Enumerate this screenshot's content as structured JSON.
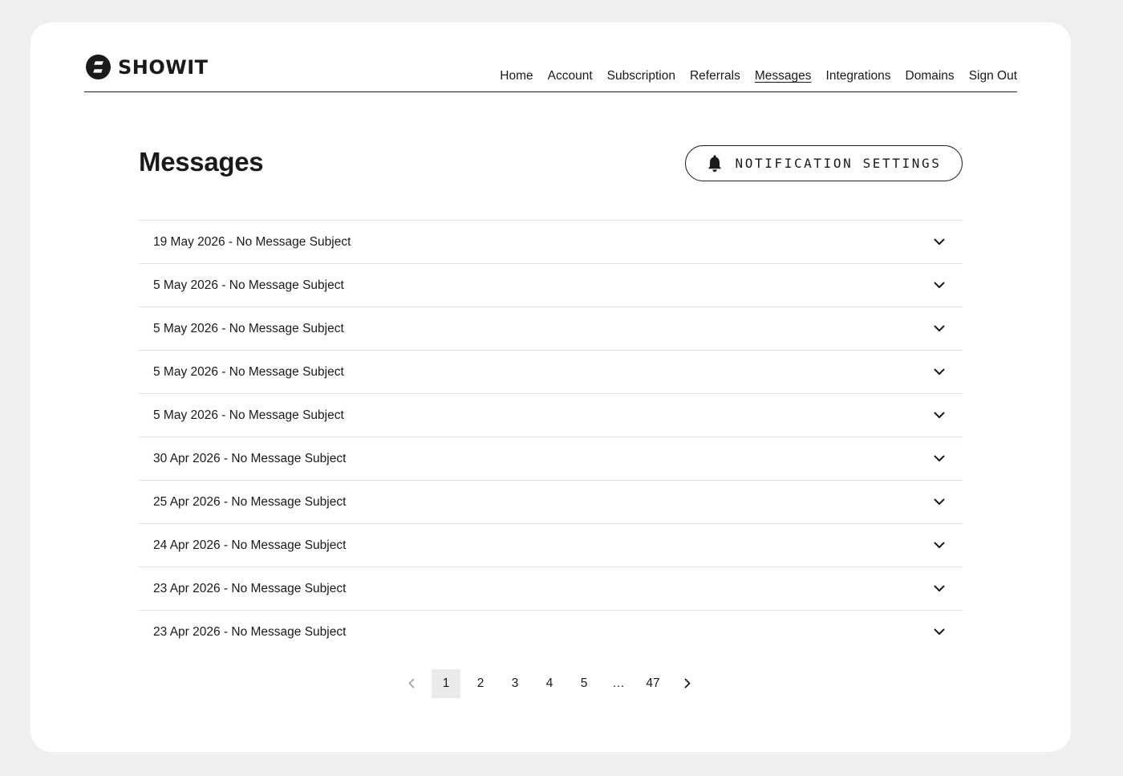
{
  "brand": {
    "name": "SHOWIT"
  },
  "nav": {
    "items": [
      {
        "label": "Home",
        "active": false
      },
      {
        "label": "Account",
        "active": false
      },
      {
        "label": "Subscription",
        "active": false
      },
      {
        "label": "Referrals",
        "active": false
      },
      {
        "label": "Messages",
        "active": true
      },
      {
        "label": "Integrations",
        "active": false
      },
      {
        "label": "Domains",
        "active": false
      },
      {
        "label": "Sign Out",
        "active": false
      }
    ]
  },
  "page": {
    "title": "Messages",
    "notification_button": "NOTIFICATION SETTINGS"
  },
  "messages": [
    {
      "date": "19 May 2026",
      "subject": "No Message Subject",
      "text": "19 May 2026 - No Message Subject"
    },
    {
      "date": "5 May 2026",
      "subject": "No Message Subject",
      "text": "5 May 2026 - No Message Subject"
    },
    {
      "date": "5 May 2026",
      "subject": "No Message Subject",
      "text": "5 May 2026 - No Message Subject"
    },
    {
      "date": "5 May 2026",
      "subject": "No Message Subject",
      "text": "5 May 2026 - No Message Subject"
    },
    {
      "date": "5 May 2026",
      "subject": "No Message Subject",
      "text": "5 May 2026 - No Message Subject"
    },
    {
      "date": "30 Apr 2026",
      "subject": "No Message Subject",
      "text": "30 Apr 2026 - No Message Subject"
    },
    {
      "date": "25 Apr 2026",
      "subject": "No Message Subject",
      "text": "25 Apr 2026 - No Message Subject"
    },
    {
      "date": "24 Apr 2026",
      "subject": "No Message Subject",
      "text": "24 Apr 2026 - No Message Subject"
    },
    {
      "date": "23 Apr 2026",
      "subject": "No Message Subject",
      "text": "23 Apr 2026 - No Message Subject"
    },
    {
      "date": "23 Apr 2026",
      "subject": "No Message Subject",
      "text": "23 Apr 2026 - No Message Subject"
    }
  ],
  "pagination": {
    "current": "1",
    "pages": [
      "1",
      "2",
      "3",
      "4",
      "5",
      "…",
      "47"
    ]
  },
  "icons": {
    "logo": "showit-logo-icon",
    "bell": "bell-icon",
    "expand": "chevron-down-icon",
    "prev": "chevron-left-icon",
    "next": "chevron-right-icon"
  },
  "colors": {
    "page_background": "#eeeff0",
    "card_background": "#ffffff",
    "text": "#1a1a1a",
    "divider": "#e1e1e1",
    "current_page_highlight": "#eaeaea",
    "disabled_arrow": "#a0a0a0"
  }
}
